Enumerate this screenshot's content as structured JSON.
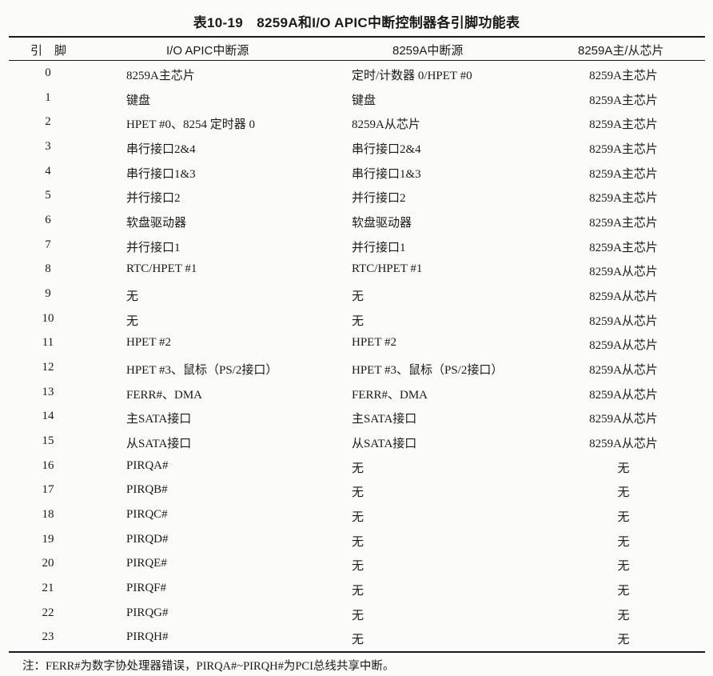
{
  "title": "表10-19　8259A和I/O APIC中断控制器各引脚功能表",
  "headers": {
    "pin": "引　脚",
    "apic": "I/O APIC中断源",
    "pic": "8259A中断源",
    "master_slave": "8259A主/从芯片"
  },
  "rows": [
    {
      "pin": "0",
      "apic": "8259A主芯片",
      "pic": "定时/计数器 0/HPET #0",
      "ms": "8259A主芯片"
    },
    {
      "pin": "1",
      "apic": "键盘",
      "pic": "键盘",
      "ms": "8259A主芯片"
    },
    {
      "pin": "2",
      "apic": "HPET #0、8254 定时器 0",
      "pic": "8259A从芯片",
      "ms": "8259A主芯片"
    },
    {
      "pin": "3",
      "apic": "串行接口2&4",
      "pic": "串行接口2&4",
      "ms": "8259A主芯片"
    },
    {
      "pin": "4",
      "apic": "串行接口1&3",
      "pic": "串行接口1&3",
      "ms": "8259A主芯片"
    },
    {
      "pin": "5",
      "apic": "并行接口2",
      "pic": "并行接口2",
      "ms": "8259A主芯片"
    },
    {
      "pin": "6",
      "apic": "软盘驱动器",
      "pic": "软盘驱动器",
      "ms": "8259A主芯片"
    },
    {
      "pin": "7",
      "apic": "并行接口1",
      "pic": "并行接口1",
      "ms": "8259A主芯片"
    },
    {
      "pin": "8",
      "apic": "RTC/HPET #1",
      "pic": "RTC/HPET #1",
      "ms": "8259A从芯片"
    },
    {
      "pin": "9",
      "apic": "无",
      "pic": "无",
      "ms": "8259A从芯片"
    },
    {
      "pin": "10",
      "apic": "无",
      "pic": "无",
      "ms": "8259A从芯片"
    },
    {
      "pin": "11",
      "apic": "HPET #2",
      "pic": "HPET #2",
      "ms": "8259A从芯片"
    },
    {
      "pin": "12",
      "apic": "HPET #3、鼠标（PS/2接口）",
      "pic": "HPET #3、鼠标（PS/2接口）",
      "ms": "8259A从芯片"
    },
    {
      "pin": "13",
      "apic": "FERR#、DMA",
      "pic": "FERR#、DMA",
      "ms": "8259A从芯片"
    },
    {
      "pin": "14",
      "apic": "主SATA接口",
      "pic": "主SATA接口",
      "ms": "8259A从芯片"
    },
    {
      "pin": "15",
      "apic": "从SATA接口",
      "pic": "从SATA接口",
      "ms": "8259A从芯片"
    },
    {
      "pin": "16",
      "apic": "PIRQA#",
      "pic": "无",
      "ms": "无"
    },
    {
      "pin": "17",
      "apic": "PIRQB#",
      "pic": "无",
      "ms": "无"
    },
    {
      "pin": "18",
      "apic": "PIRQC#",
      "pic": "无",
      "ms": "无"
    },
    {
      "pin": "19",
      "apic": "PIRQD#",
      "pic": "无",
      "ms": "无"
    },
    {
      "pin": "20",
      "apic": "PIRQE#",
      "pic": "无",
      "ms": "无"
    },
    {
      "pin": "21",
      "apic": "PIRQF#",
      "pic": "无",
      "ms": "无"
    },
    {
      "pin": "22",
      "apic": "PIRQG#",
      "pic": "无",
      "ms": "无"
    },
    {
      "pin": "23",
      "apic": "PIRQH#",
      "pic": "无",
      "ms": "无"
    }
  ],
  "note": "注：FERR#为数字协处理器错误，PIRQA#~PIRQH#为PCI总线共享中断。"
}
